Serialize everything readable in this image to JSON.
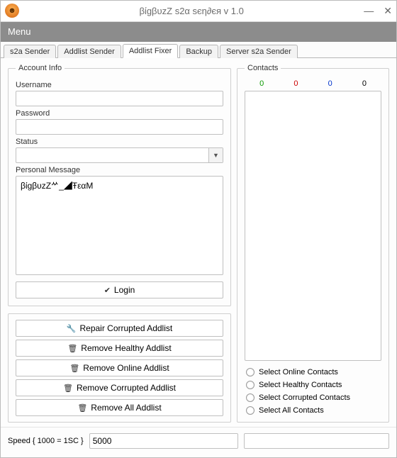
{
  "window": {
    "title": "βίgβυzZ s2α ѕєη∂єя  v 1.0"
  },
  "menu": {
    "label": "Menu"
  },
  "tabs": [
    {
      "label": "s2a Sender",
      "active": false
    },
    {
      "label": "Addlist Sender",
      "active": false
    },
    {
      "label": "Addlist Fixer",
      "active": true
    },
    {
      "label": "Backup",
      "active": false
    },
    {
      "label": "Server s2a Sender",
      "active": false
    }
  ],
  "account": {
    "legend": "Account Info",
    "username_label": "Username",
    "username_value": "",
    "password_label": "Password",
    "password_value": "",
    "status_label": "Status",
    "status_value": "",
    "pm_label": "Personal Message",
    "pm_value": "βίgβυzZᄽ_◢ŦεαM",
    "login_label": "Login"
  },
  "actions": {
    "repair": "Repair Corrupted Addlist",
    "remove_healthy": "Remove Healthy Addlist",
    "remove_online": "Remove Online Addlist",
    "remove_corrupted": "Remove Corrupted Addlist",
    "remove_all": "Remove All Addlist"
  },
  "contacts": {
    "legend": "Contacts",
    "counts": {
      "green": "0",
      "red": "0",
      "blue": "0",
      "black": "0"
    },
    "select_online": "Select Online Contacts",
    "select_healthy": "Select Healthy Contacts",
    "select_corrupted": "Select Corrupted Contacts",
    "select_all": "Select All Contacts"
  },
  "footer": {
    "speed_label": "Speed { 1000 = 1SC }",
    "speed_value": "5000",
    "output_value": ""
  }
}
